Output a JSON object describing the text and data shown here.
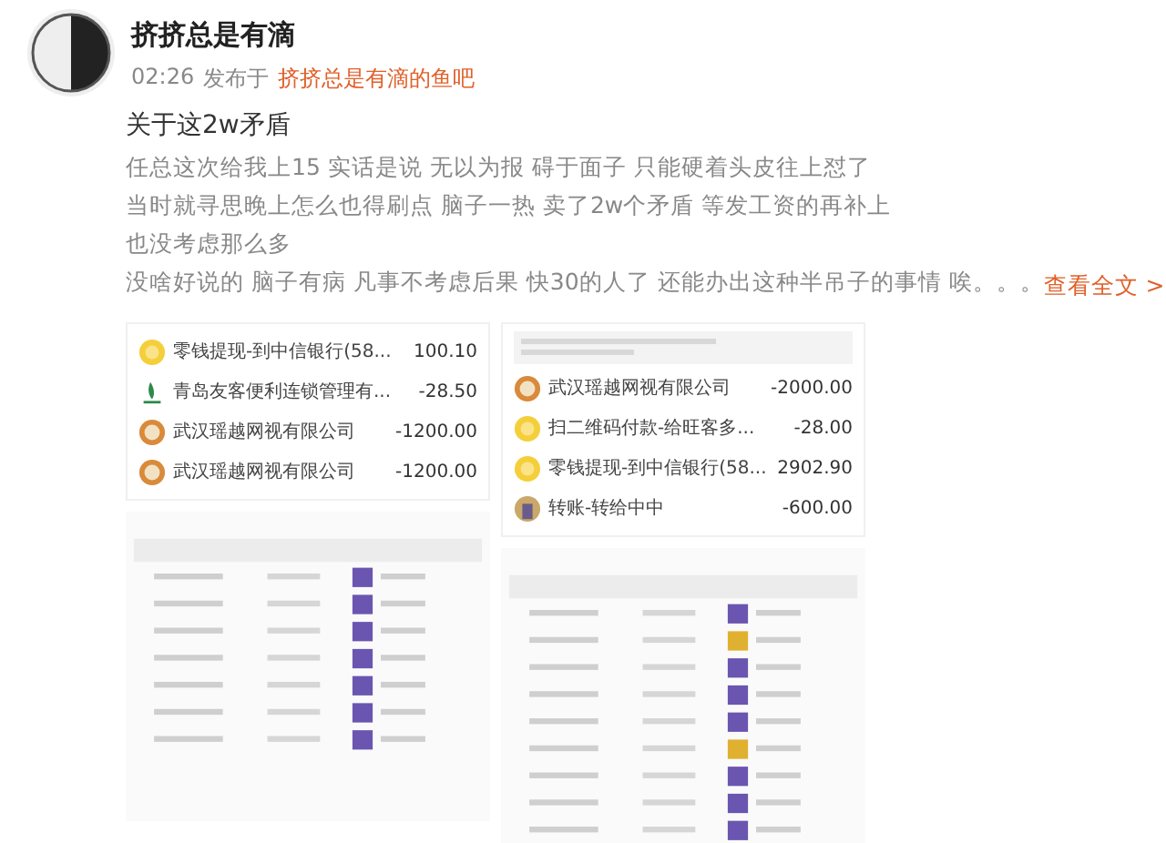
{
  "post": {
    "author": "挤挤总是有滴",
    "time": "02:26",
    "published_in_label": "发布于",
    "forum": "挤挤总是有滴的鱼吧",
    "title": "关于这2w矛盾",
    "body_lines": [
      "任总这次给我上15 实话是说  无以为报 碍于面子 只能硬着头皮往上怼了",
      "当时就寻思晚上怎么也得刷点 脑子一热 卖了2w个矛盾 等发工资的再补上",
      "也没考虑那么多",
      "没啥好说的 脑子有病 凡事不考虑后果 快30的人了 还能办出这种半吊子的事情  唉。。。"
    ],
    "read_more": "查看全文 >"
  },
  "screenshots": [
    {
      "transactions": [
        {
          "kind": "coin",
          "name": "零钱提现-到中信银行(58...",
          "amount": "100.10"
        },
        {
          "kind": "brand",
          "name": "青岛友客便利连锁管理有...",
          "amount": "-28.50"
        },
        {
          "kind": "shop",
          "name": "武汉瑶越网视有限公司",
          "amount": "-1200.00"
        },
        {
          "kind": "shop",
          "name": "武汉瑶越网视有限公司",
          "amount": "-1200.00"
        }
      ]
    },
    {
      "transactions": [
        {
          "kind": "shop",
          "name": "武汉瑶越网视有限公司",
          "amount": "-2000.00"
        },
        {
          "kind": "coin",
          "name": "扫二维码付款-给旺客多...",
          "amount": "-28.00"
        },
        {
          "kind": "coin",
          "name": "零钱提现-到中信银行(58...",
          "amount": "2902.90"
        },
        {
          "kind": "avatar",
          "name": "转账-转给中中",
          "amount": "-600.00"
        }
      ]
    }
  ]
}
